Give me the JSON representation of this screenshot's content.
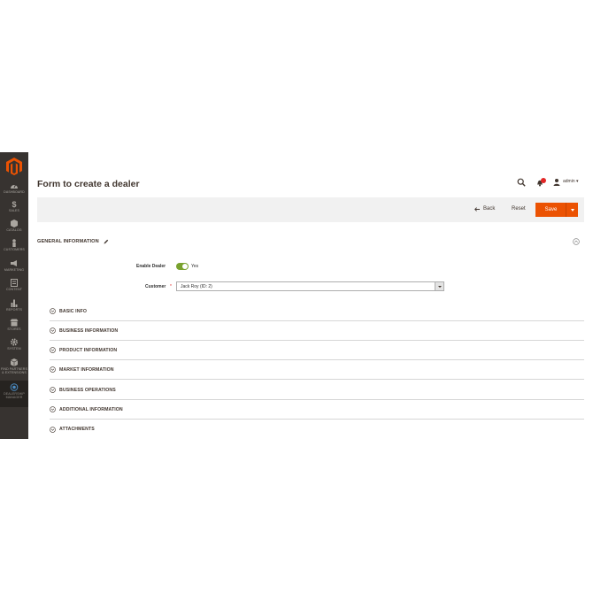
{
  "sidebar": {
    "items": [
      {
        "label": "Dashboard",
        "icon": "dashboard-icon"
      },
      {
        "label": "Sales",
        "icon": "dollar-icon"
      },
      {
        "label": "Catalog",
        "icon": "box-icon"
      },
      {
        "label": "Customers",
        "icon": "person-icon"
      },
      {
        "label": "Marketing",
        "icon": "megaphone-icon"
      },
      {
        "label": "Content",
        "icon": "content-icon"
      },
      {
        "label": "Reports",
        "icon": "bar-chart-icon"
      },
      {
        "label": "Stores",
        "icon": "store-icon"
      },
      {
        "label": "System",
        "icon": "gear-icon"
      },
      {
        "label_line1": "Find Partners",
        "label_line2": "& Extensions",
        "icon": "cube-icon"
      },
      {
        "label_line1": "Dealership",
        "label_line2": "Manager",
        "icon": "globe-icon"
      }
    ]
  },
  "header": {
    "title": "Form to create a dealer",
    "notifications_count": "1",
    "user": "admin"
  },
  "actions": {
    "back": "Back",
    "reset": "Reset",
    "save": "Save"
  },
  "general": {
    "title": "GENERAL INFORMATION",
    "enable_label": "Enable Dealer",
    "enable_value": "Yes",
    "customer_label": "Customer",
    "customer_value": "Jack Roy (ID: 2)"
  },
  "fieldsets": [
    "BASIC INFO",
    "BUSINESS INFORMATION",
    "PRODUCT INFORMATION",
    "MARKET INFORMATION",
    "BUSINESS OPERATIONS",
    "ADDITIONAL INFORMATION",
    "ATTACHMENTS"
  ],
  "colors": {
    "sidebar_bg": "#373330",
    "accent": "#eb5202",
    "toggle_on": "#79a22e",
    "action_bar_bg": "#f1f1f1"
  }
}
